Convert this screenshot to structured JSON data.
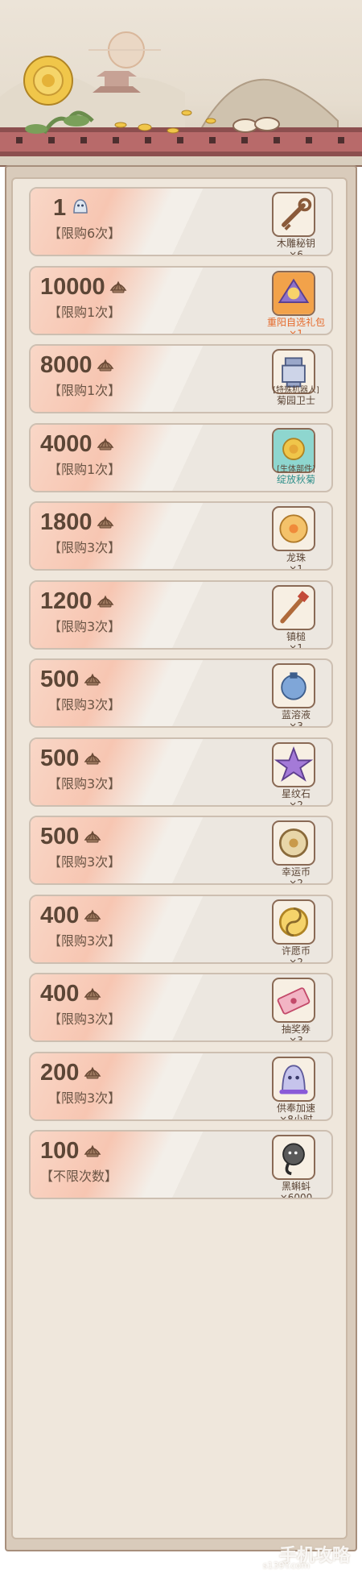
{
  "items": [
    {
      "price": "1",
      "limit": "【限购6次】",
      "name": "木雕秘钥",
      "qty": "×6",
      "currency": "ghost-coin-icon",
      "icon": "wooden-key-icon"
    },
    {
      "price": "10000",
      "limit": "【限购1次】",
      "name": "重阳自选礼包",
      "qty": "×1",
      "currency": "shell-icon",
      "icon": "gift-pack-icon"
    },
    {
      "price": "8000",
      "limit": "【限购1次】",
      "name": "菊园卫士",
      "tag": "[特殊机器人]",
      "qty": "",
      "currency": "shell-icon",
      "icon": "robot-icon"
    },
    {
      "price": "4000",
      "limit": "【限购1次】",
      "name": "绽放秋菊",
      "tag": "[生体部件]",
      "qty": "",
      "currency": "shell-icon",
      "icon": "chrysanthemum-icon"
    },
    {
      "price": "1800",
      "limit": "【限购3次】",
      "name": "龙珠",
      "qty": "×1",
      "currency": "shell-icon",
      "icon": "dragon-pearl-icon"
    },
    {
      "price": "1200",
      "limit": "【限购3次】",
      "name": "镇槌",
      "qty": "×1",
      "currency": "shell-icon",
      "icon": "mallet-icon"
    },
    {
      "price": "500",
      "limit": "【限购3次】",
      "name": "蓝溶液",
      "qty": "×3",
      "currency": "shell-icon",
      "icon": "blue-potion-icon"
    },
    {
      "price": "500",
      "limit": "【限购3次】",
      "name": "星纹石",
      "qty": "×2",
      "currency": "shell-icon",
      "icon": "star-stone-icon"
    },
    {
      "price": "500",
      "limit": "【限购3次】",
      "name": "幸运币",
      "qty": "×2",
      "currency": "shell-icon",
      "icon": "lucky-coin-icon"
    },
    {
      "price": "400",
      "limit": "【限购3次】",
      "name": "许愿币",
      "qty": "×2",
      "currency": "shell-icon",
      "icon": "wish-coin-icon"
    },
    {
      "price": "400",
      "limit": "【限购3次】",
      "name": "抽奖券",
      "qty": "×3",
      "currency": "shell-icon",
      "icon": "lottery-ticket-icon"
    },
    {
      "price": "200",
      "limit": "【限购3次】",
      "name": "供奉加速",
      "qty": "×8小时",
      "currency": "shell-icon",
      "icon": "speedup-icon"
    },
    {
      "price": "100",
      "limit": "【不限次数】",
      "name": "黑蝌蚪",
      "qty": "×6000",
      "currency": "shell-icon",
      "icon": "black-tadpole-icon"
    }
  ],
  "watermark": {
    "line1": "手机攻略",
    "line2": "s139Y.com"
  }
}
